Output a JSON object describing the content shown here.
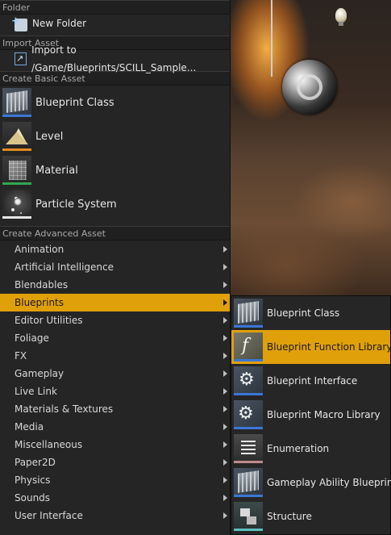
{
  "colors": {
    "menu_bg": "#252525",
    "highlight": "#e0a00a",
    "blueprint_bar": "#3b77d6",
    "level_bar": "#e58a1e",
    "material_bar": "#2fa84f",
    "particle_bar": "#e6e6e6",
    "enum_bar": "#c08b8b",
    "struct_bar": "#5fbfbf"
  },
  "menu": {
    "folder_section": {
      "header": "Folder",
      "items": [
        {
          "label": "New Folder",
          "icon": "new-folder-icon"
        }
      ]
    },
    "import_section": {
      "header": "Import Asset",
      "items": [
        {
          "label": "Import to /Game/Blueprints/SCILL_Sample...",
          "icon": "import-icon"
        }
      ]
    },
    "basic_section": {
      "header": "Create Basic Asset",
      "items": [
        {
          "label": "Blueprint Class",
          "icon": "blueprint-class-icon"
        },
        {
          "label": "Level",
          "icon": "level-icon"
        },
        {
          "label": "Material",
          "icon": "material-icon"
        },
        {
          "label": "Particle System",
          "icon": "particle-system-icon"
        }
      ]
    },
    "advanced_section": {
      "header": "Create Advanced Asset",
      "items": [
        {
          "label": "Animation"
        },
        {
          "label": "Artificial Intelligence"
        },
        {
          "label": "Blendables"
        },
        {
          "label": "Blueprints",
          "active": true
        },
        {
          "label": "Editor Utilities"
        },
        {
          "label": "Foliage"
        },
        {
          "label": "FX"
        },
        {
          "label": "Gameplay"
        },
        {
          "label": "Live Link"
        },
        {
          "label": "Materials & Textures"
        },
        {
          "label": "Media"
        },
        {
          "label": "Miscellaneous"
        },
        {
          "label": "Paper2D"
        },
        {
          "label": "Physics"
        },
        {
          "label": "Sounds"
        },
        {
          "label": "User Interface"
        }
      ]
    }
  },
  "submenu": {
    "items": [
      {
        "label": "Blueprint Class",
        "icon": "blueprint-class-icon"
      },
      {
        "label": "Blueprint Function Library",
        "icon": "function-library-icon",
        "active": true
      },
      {
        "label": "Blueprint Interface",
        "icon": "blueprint-interface-icon"
      },
      {
        "label": "Blueprint Macro Library",
        "icon": "macro-library-icon"
      },
      {
        "label": "Enumeration",
        "icon": "enumeration-icon"
      },
      {
        "label": "Gameplay Ability Blueprint",
        "icon": "gameplay-ability-icon"
      },
      {
        "label": "Structure",
        "icon": "structure-icon"
      }
    ]
  }
}
